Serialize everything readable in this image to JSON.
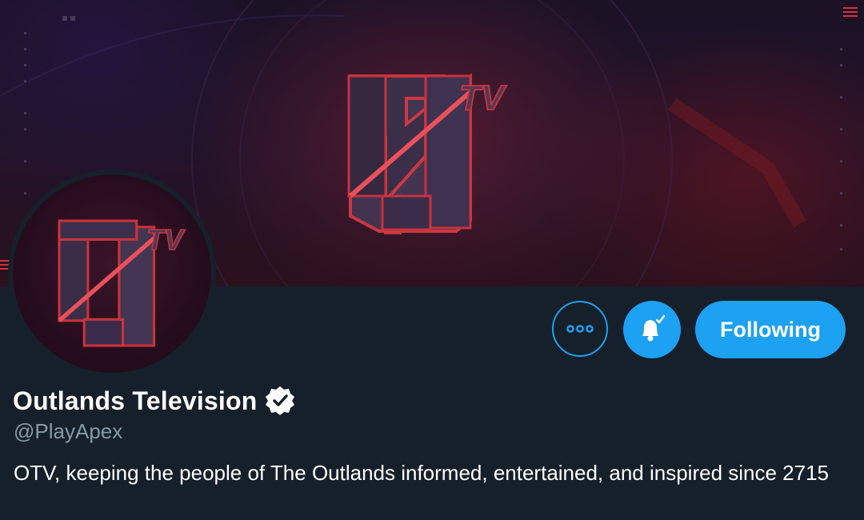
{
  "banner": {
    "logo_text": "OTV",
    "logo_tv": "TV"
  },
  "profile": {
    "display_name": "Outlands Television",
    "handle": "@PlayApex",
    "bio": "OTV, keeping the people of The Outlands informed, entertained, and inspired since 2715",
    "verified": true
  },
  "actions": {
    "more_icon": "more-horizontal-icon",
    "notify_icon": "bell-check-icon",
    "follow_label": "Following"
  },
  "colors": {
    "accent": "#1da1f2",
    "background": "#15202b",
    "secondary_text": "#8899a6",
    "brand_red": "#d8303a"
  }
}
